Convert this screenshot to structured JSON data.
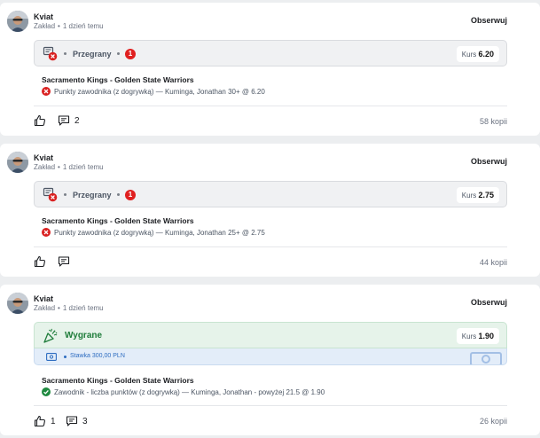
{
  "posts": [
    {
      "user": "Kviat",
      "type": "Zakład",
      "time": "1 dzień temu",
      "follow": "Obserwuj",
      "status": "Przegrany",
      "status_count": "1",
      "odds_label": "Kurs",
      "odds": "6.20",
      "match": "Sacramento Kings - Golden State Warriors",
      "selection": "Punkty zawodnika (z dogrywką) — Kuminga, Jonathan 30+ @ 6.20",
      "likes": "",
      "comments": "2",
      "copies": "58 kopii"
    },
    {
      "user": "Kviat",
      "type": "Zakład",
      "time": "1 dzień temu",
      "follow": "Obserwuj",
      "status": "Przegrany",
      "status_count": "1",
      "odds_label": "Kurs",
      "odds": "2.75",
      "match": "Sacramento Kings - Golden State Warriors",
      "selection": "Punkty zawodnika (z dogrywką) — Kuminga, Jonathan 25+ @ 2.75",
      "likes": "",
      "comments": "",
      "copies": "44 kopii"
    },
    {
      "user": "Kviat",
      "type": "Zakład",
      "time": "1 dzień temu",
      "follow": "Obserwuj",
      "status": "Wygrane",
      "odds_label": "Kurs",
      "odds": "1.90",
      "stake": "Stawka 300,00 PLN",
      "match": "Sacramento Kings - Golden State Warriors",
      "selection": "Zawodnik - liczba punktów (z dogrywką) — Kuminga, Jonathan - powyżej 21.5 @ 1.90",
      "likes": "1",
      "comments": "3",
      "copies": "26 kopii"
    }
  ],
  "colors": {
    "lost": "#d92121",
    "won": "#1f8a40",
    "won_bg": "#e6f3ea",
    "stake": "#2d6cc0"
  },
  "icons": {
    "avatar": "avatar",
    "lost_status": "ticket-lost-icon",
    "won_status": "party-popper-icon",
    "like": "thumbs-up-icon",
    "comment": "comment-icon",
    "stake": "money-icon"
  }
}
